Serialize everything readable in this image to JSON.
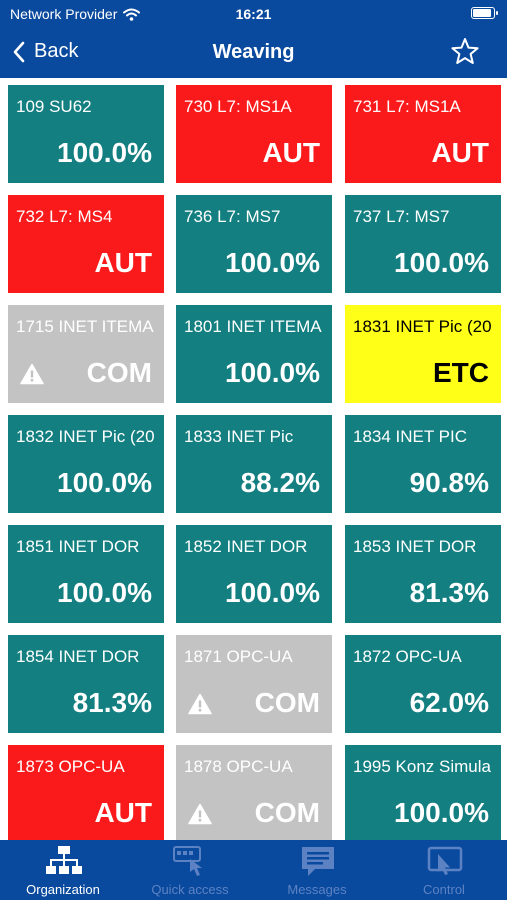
{
  "status_bar": {
    "carrier": "Network Provider",
    "time": "16:21",
    "battery_level": 0.95
  },
  "nav": {
    "back_label": "Back",
    "title": "Weaving",
    "favorite_icon": "star-icon"
  },
  "colors": {
    "bar_blue": "#0a4a9e",
    "teal": "#137f80",
    "red": "#fb1a1b",
    "gray": "#c3c3c3",
    "yellow": "#ffff18"
  },
  "tiles": [
    {
      "name": "109 SU62",
      "value": "100.0%",
      "state": "teal",
      "warning": false
    },
    {
      "name": "730 L7: MS1A",
      "value": "AUT",
      "state": "red",
      "warning": false
    },
    {
      "name": "731 L7: MS1A",
      "value": "AUT",
      "state": "red",
      "warning": false
    },
    {
      "name": "732 L7: MS4",
      "value": "AUT",
      "state": "red",
      "warning": false
    },
    {
      "name": "736 L7: MS7",
      "value": "100.0%",
      "state": "teal",
      "warning": false
    },
    {
      "name": "737 L7: MS7",
      "value": "100.0%",
      "state": "teal",
      "warning": false
    },
    {
      "name": "1715 INET ITEMA",
      "value": "COM",
      "state": "gray",
      "warning": true
    },
    {
      "name": "1801 INET ITEMA",
      "value": "100.0%",
      "state": "teal",
      "warning": false
    },
    {
      "name": "1831 INET Pic (20",
      "value": "ETC",
      "state": "yellow",
      "warning": false
    },
    {
      "name": "1832 INET Pic (20",
      "value": "100.0%",
      "state": "teal",
      "warning": false
    },
    {
      "name": "1833 INET Pic",
      "value": "88.2%",
      "state": "teal",
      "warning": false
    },
    {
      "name": "1834 INET PIC",
      "value": "90.8%",
      "state": "teal",
      "warning": false
    },
    {
      "name": "1851 INET DOR",
      "value": "100.0%",
      "state": "teal",
      "warning": false
    },
    {
      "name": "1852 INET DOR",
      "value": "100.0%",
      "state": "teal",
      "warning": false
    },
    {
      "name": "1853 INET DOR",
      "value": "81.3%",
      "state": "teal",
      "warning": false
    },
    {
      "name": "1854 INET DOR",
      "value": "81.3%",
      "state": "teal",
      "warning": false
    },
    {
      "name": "1871 OPC-UA",
      "value": "COM",
      "state": "gray",
      "warning": true
    },
    {
      "name": "1872 OPC-UA",
      "value": "62.0%",
      "state": "teal",
      "warning": false
    },
    {
      "name": "1873 OPC-UA",
      "value": "AUT",
      "state": "red",
      "warning": false
    },
    {
      "name": "1878 OPC-UA",
      "value": "COM",
      "state": "gray",
      "warning": true
    },
    {
      "name": "1995 Konz Simula",
      "value": "100.0%",
      "state": "teal",
      "warning": false
    }
  ],
  "tabs": [
    {
      "label": "Organization",
      "icon": "organization-chart-icon",
      "active": true
    },
    {
      "label": "Quick access",
      "icon": "quick-access-icon",
      "active": false
    },
    {
      "label": "Messages",
      "icon": "messages-icon",
      "active": false
    },
    {
      "label": "Control",
      "icon": "control-icon",
      "active": false
    }
  ]
}
